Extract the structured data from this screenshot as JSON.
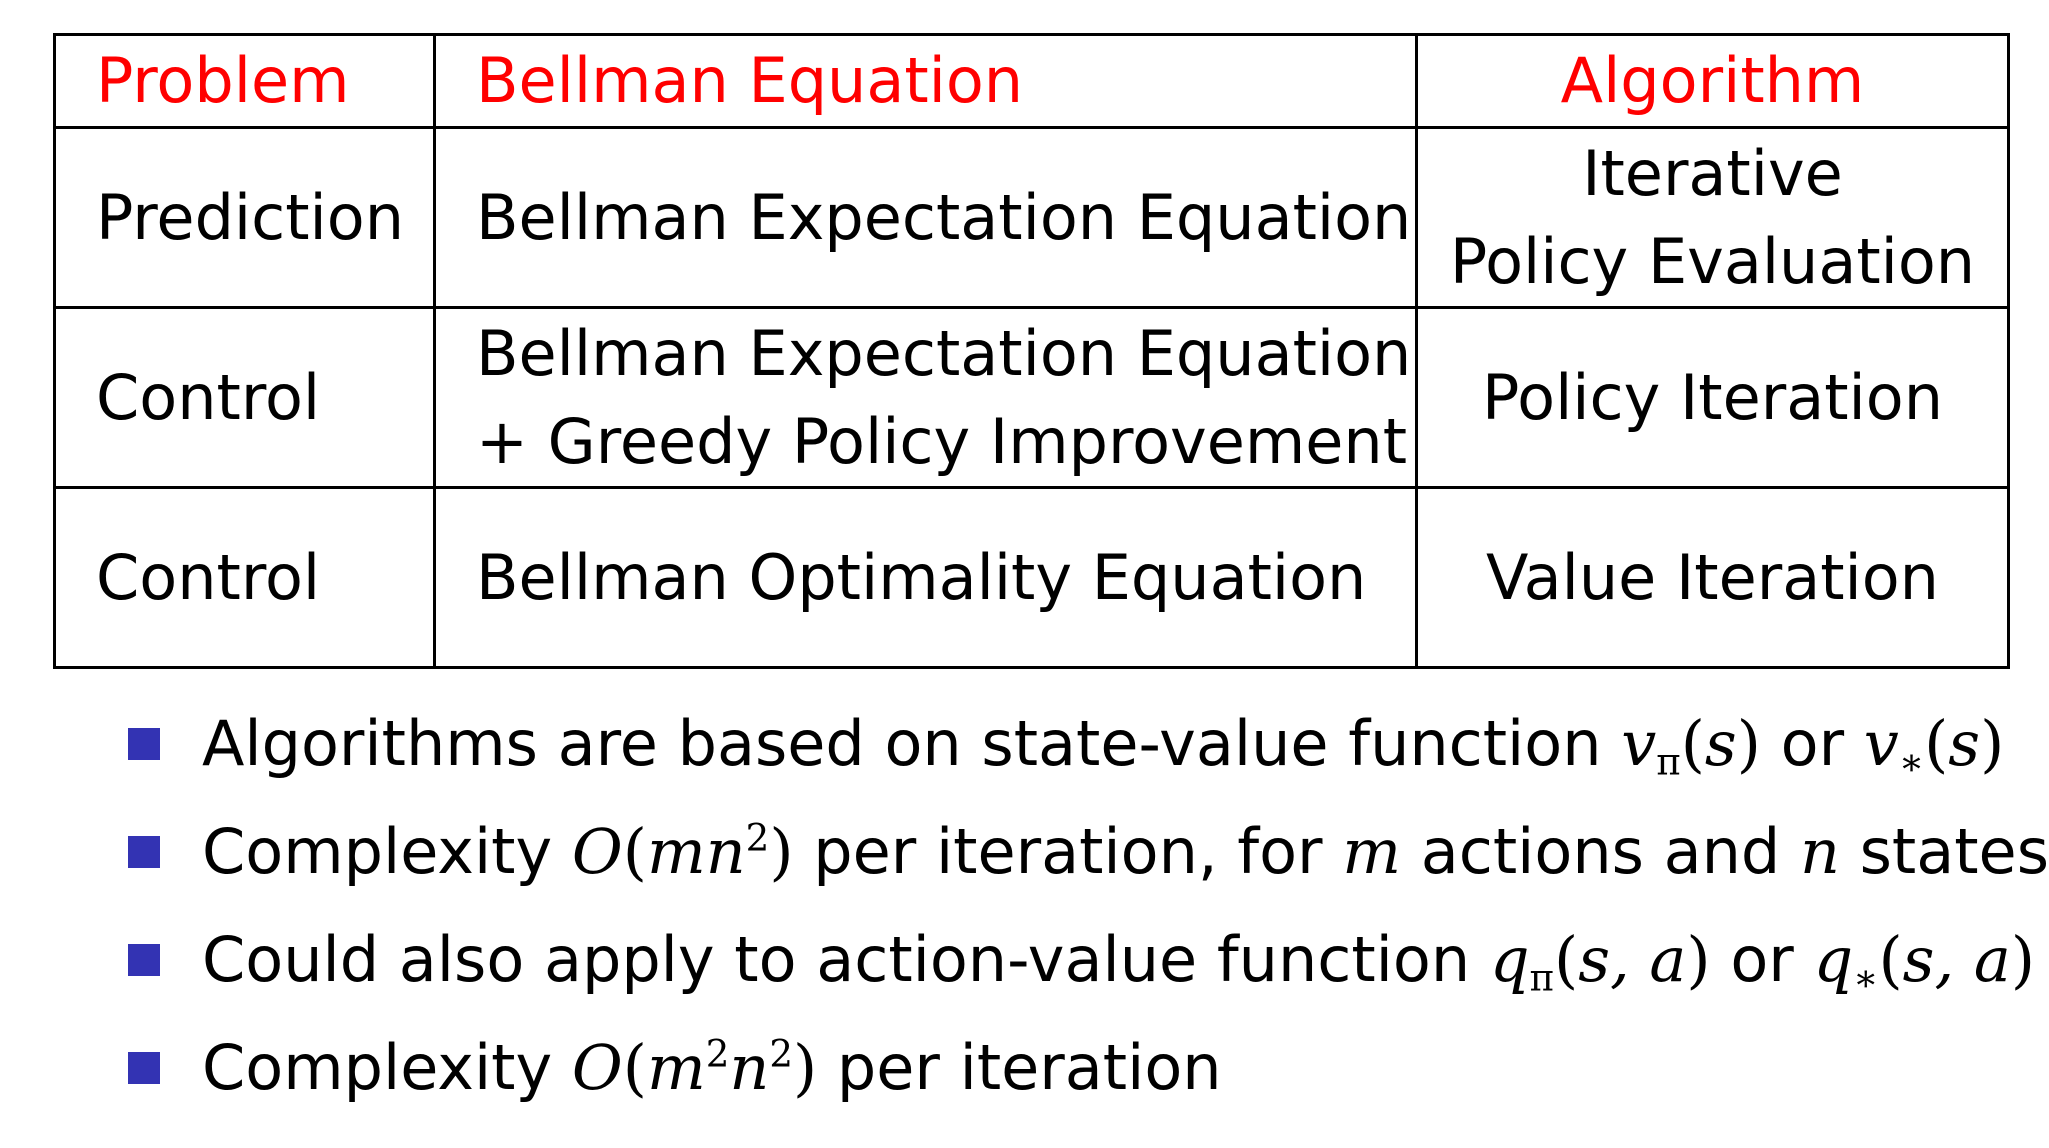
{
  "table": {
    "headers": {
      "problem": "Problem",
      "equation": "Bellman Equation",
      "algorithm": "Algorithm"
    },
    "header_color": "#ff0000",
    "rows": [
      {
        "problem": "Prediction",
        "equation": [
          "Bellman Expectation Equation"
        ],
        "algorithm": [
          "Iterative",
          "Policy Evaluation"
        ]
      },
      {
        "problem": "Control",
        "equation": [
          "Bellman Expectation Equation",
          "+ Greedy Policy Improvement"
        ],
        "algorithm": [
          "Policy Iteration"
        ]
      },
      {
        "problem": "Control",
        "equation": [
          "Bellman Optimality Equation"
        ],
        "algorithm": [
          "Value Iteration"
        ]
      }
    ]
  },
  "bullet_color": "#3333b3",
  "bullets": [
    {
      "text_before": "Algorithms are based on state-value function ",
      "math_1": {
        "var": "v",
        "sub": "π",
        "args": "s"
      },
      "connector": " or ",
      "math_2": {
        "var": "v",
        "sub": "∗",
        "args": "s"
      }
    },
    {
      "text_before": "Complexity ",
      "math": {
        "fn": "O",
        "inner": "mn",
        "exp": "2"
      },
      "text_mid": " per iteration, for ",
      "var_m": "m",
      "text_mid2": " actions and ",
      "var_n": "n",
      "text_after": " states"
    },
    {
      "text_before": "Could also apply to action-value function ",
      "math_1": {
        "var": "q",
        "sub": "π",
        "args": "s, a"
      },
      "connector": " or ",
      "math_2": {
        "var": "q",
        "sub": "∗",
        "args": "s, a"
      }
    },
    {
      "text_before": "Complexity ",
      "math": {
        "fn": "O",
        "inner_1": "m",
        "exp_1": "2",
        "inner_2": "n",
        "exp_2": "2"
      },
      "text_after": " per iteration"
    }
  ]
}
